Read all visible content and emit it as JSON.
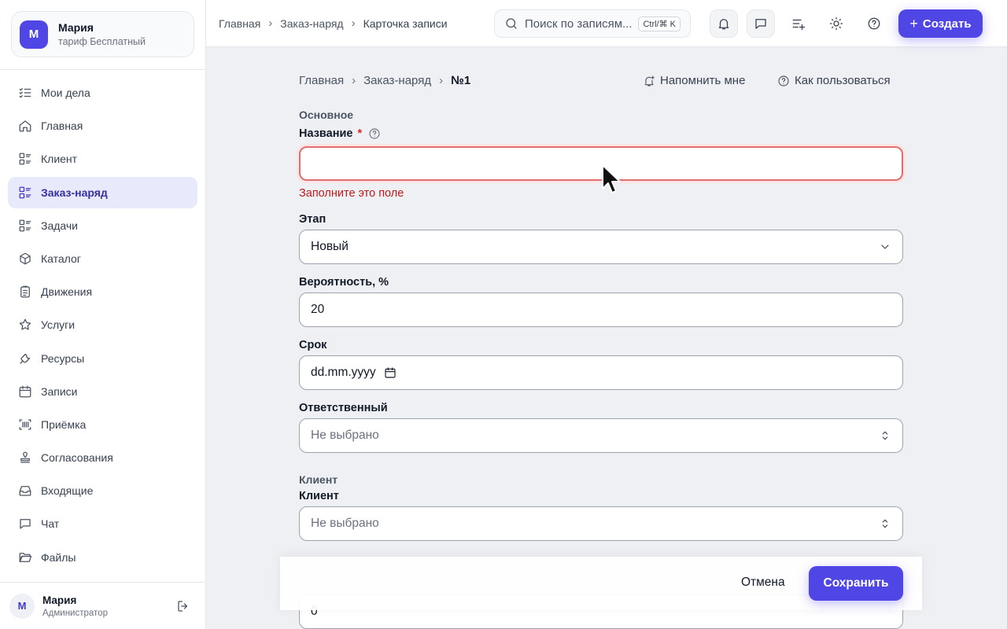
{
  "account": {
    "initial": "М",
    "name": "Мария",
    "plan": "тариф Бесплатный"
  },
  "sidebar": {
    "items": [
      {
        "label": "Мои дела",
        "icon": "checklist-icon"
      },
      {
        "label": "Главная",
        "icon": "home-icon"
      },
      {
        "label": "Клиент",
        "icon": "list-grid-icon"
      },
      {
        "label": "Заказ-наряд",
        "icon": "list-grid-icon",
        "active": true
      },
      {
        "label": "Задачи",
        "icon": "list-grid-icon"
      },
      {
        "label": "Каталог",
        "icon": "box-icon"
      },
      {
        "label": "Движения",
        "icon": "clipboard-icon"
      },
      {
        "label": "Услуги",
        "icon": "star-icon"
      },
      {
        "label": "Ресурсы",
        "icon": "wrench-icon"
      },
      {
        "label": "Записи",
        "icon": "calendar-icon"
      },
      {
        "label": "Приёмка",
        "icon": "scan-icon"
      },
      {
        "label": "Согласования",
        "icon": "stamp-icon"
      },
      {
        "label": "Входящие",
        "icon": "inbox-icon"
      },
      {
        "label": "Чат",
        "icon": "chat-icon"
      },
      {
        "label": "Файлы",
        "icon": "folder-icon"
      }
    ]
  },
  "user": {
    "initial": "М",
    "name": "Мария",
    "role": "Администратор"
  },
  "topbar": {
    "breadcrumb": [
      "Главная",
      "Заказ-наряд",
      "Карточка записи"
    ],
    "search_placeholder": "Поиск по записям...",
    "search_shortcut": "Ctrl/⌘ K",
    "create_label": "Создать"
  },
  "page": {
    "breadcrumb": [
      "Главная",
      "Заказ-наряд",
      "№1"
    ],
    "remind_label": "Напомнить мне",
    "howto_label": "Как пользоваться"
  },
  "form": {
    "section_main": "Основное",
    "name_label": "Название",
    "name_required": "*",
    "name_value": "",
    "name_error": "Заполните это поле",
    "stage_label": "Этап",
    "stage_value": "Новый",
    "probability_label": "Вероятность, %",
    "probability_value": "20",
    "deadline_label": "Срок",
    "deadline_placeholder": "dd.mm.yyyy",
    "responsible_label": "Ответственный",
    "responsible_value": "Не выбрано",
    "section_client": "Клиент",
    "client_label": "Клиент",
    "client_value": "Не выбрано",
    "next_field_value": "0"
  },
  "footer": {
    "cancel_label": "Отмена",
    "save_label": "Сохранить"
  },
  "colors": {
    "accent": "#4f46e5",
    "error": "#b91c1c",
    "active_bg": "#e9e9fc"
  }
}
